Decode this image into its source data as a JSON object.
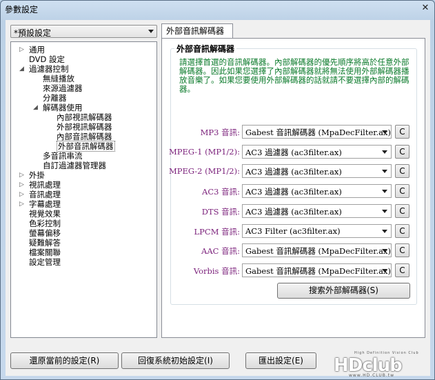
{
  "window": {
    "title": "參數設定"
  },
  "preset": {
    "value": "*預設設定"
  },
  "tree": [
    {
      "label": "通用",
      "exp": "▷"
    },
    {
      "label": "DVD 設定",
      "exp": ""
    },
    {
      "label": "過濾器控制",
      "exp": "◢"
    },
    {
      "label": "無縫播放",
      "exp": ""
    },
    {
      "label": "來源過濾器",
      "exp": ""
    },
    {
      "label": "分離器",
      "exp": ""
    },
    {
      "label": "解碼器使用",
      "exp": "◢"
    },
    {
      "label": "內部視訊解碼器",
      "exp": ""
    },
    {
      "label": "外部視訊解碼器",
      "exp": ""
    },
    {
      "label": "內部音訊解碼器",
      "exp": ""
    },
    {
      "label": "外部音訊解碼器",
      "exp": ""
    },
    {
      "label": "多音訊串流",
      "exp": ""
    },
    {
      "label": "自訂過濾器管理器",
      "exp": ""
    },
    {
      "label": "外掛",
      "exp": "▷"
    },
    {
      "label": "視訊處理",
      "exp": "▷"
    },
    {
      "label": "音訊處理",
      "exp": "▷"
    },
    {
      "label": "字幕處理",
      "exp": "▷"
    },
    {
      "label": "視覺效果",
      "exp": ""
    },
    {
      "label": "色彩控制",
      "exp": ""
    },
    {
      "label": "螢幕偏移",
      "exp": ""
    },
    {
      "label": "疑難解答",
      "exp": ""
    },
    {
      "label": "檔案關聯",
      "exp": ""
    },
    {
      "label": "設定管理",
      "exp": ""
    }
  ],
  "tab": {
    "label": "外部音訊解碼器"
  },
  "group": {
    "title": "外部音訊解碼器",
    "description": "請選擇首選的音訊解碼器。內部解碼器的優先順序將高於任意外部解碼器。因此如果您選擇了內部解碼器就將無法使用外部解碼器播放音樂了。如果您要使用外部解碼器的話就請不要選擇內部的解碼器。"
  },
  "decoders": [
    {
      "label": "MP3 音訊:",
      "value": "Gabest 音訊解碼器 (MpaDecFilter.ax)",
      "btn": "C"
    },
    {
      "label": "MPEG-1 (MP1/2):",
      "value": "AC3 過濾器 (ac3filter.ax)",
      "btn": "C"
    },
    {
      "label": "MPEG-2 (MP1/2):",
      "value": "AC3 過濾器 (ac3filter.ax)",
      "btn": "C"
    },
    {
      "label": "AC3 音訊:",
      "value": "AC3 過濾器 (ac3filter.ax)",
      "btn": "C"
    },
    {
      "label": "DTS 音訊:",
      "value": "AC3 過濾器 (ac3filter.ax)",
      "btn": "C"
    },
    {
      "label": "LPCM 音訊:",
      "value": "AC3 Filter (ac3filter.ax)",
      "btn": "C"
    },
    {
      "label": "AAC 音訊:",
      "value": "Gabest 音訊解碼器 (MpaDecFilter.ax)",
      "btn": "C"
    },
    {
      "label": "Vorbis 音訊:",
      "value": "Gabest 音訊解碼器 (MpaDecFilter.ax)",
      "btn": "C"
    }
  ],
  "search_button": "搜索外部解碼器(S)",
  "bottom": {
    "restore": "還原當前的設定(R)",
    "reset": "回復系統初始設定(I)",
    "export": "匯出設定(E)"
  },
  "watermark": {
    "logo": "HDclub",
    "tagline": "High Definition Vision Club",
    "url": "www.HD.CLUB.tw"
  }
}
